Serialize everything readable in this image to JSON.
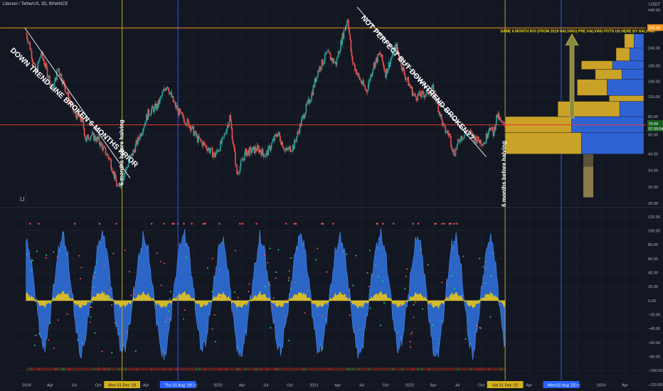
{
  "header": {
    "symbol_text": "Litecoin / TetherUS, 3D, BINANCE",
    "currency": "USDT"
  },
  "logo_text": "ʇ⅃",
  "colors": {
    "background": "#131722",
    "grid": "#1f2433",
    "candle_up": "#26a69a",
    "candle_down": "#ef5350",
    "trend_line": "#e8e8e8",
    "horizontal_orange": "#f7931a",
    "horizontal_red": "#e53935",
    "vertical_yellow": "#d6b01e",
    "vertical_blue": "#2962ff",
    "osc_blue": "#2f6ed8",
    "osc_yellow": "#e5c21b",
    "annotation_yellow": "#f5d90a",
    "vp_gold": "#c9a227",
    "vp_blue": "#2f63d3",
    "vp_tan": "#8b7a4a",
    "arrow_fill": "#8b8a3a",
    "price_tag": "#1b5e20"
  },
  "chart_data": [
    {
      "type": "candlestick",
      "title": "Litecoin / TetherUS, 3D, BINANCE",
      "y_scale": "log",
      "ylim": [
        20,
        460
      ],
      "y_ticks": [
        {
          "value": 440,
          "label": "440.00"
        },
        {
          "value": 320,
          "label": "320.00"
        },
        {
          "value": 240,
          "label": "240.00"
        },
        {
          "value": 180,
          "label": "180.00"
        },
        {
          "value": 140,
          "label": "140.00"
        },
        {
          "value": 110,
          "label": "110.00"
        },
        {
          "value": 80,
          "label": "80.00"
        },
        {
          "value": 60,
          "label": "60.00"
        },
        {
          "value": 44,
          "label": "44.00"
        },
        {
          "value": 34,
          "label": "34.00"
        },
        {
          "value": 26,
          "label": "26.00"
        },
        {
          "value": 20,
          "label": "20.00"
        }
      ],
      "x_ticks": [
        "2018",
        "Apr",
        "Jul",
        "Oct",
        "Mon 31 Dec '18",
        "Apr",
        "Thu 01 Aug '19",
        "Oct",
        "2020",
        "Apr",
        "Jul",
        "Oct",
        "2021",
        "Apr",
        "Jul",
        "Oct",
        "2022",
        "Apr",
        "Jul",
        "Oct",
        "Sat 31 Dec '22",
        "Apr",
        "Wed 02 Aug '23",
        "Oct",
        "2024",
        "Apr"
      ],
      "price_path": [
        {
          "date": "2017-12-30",
          "close": 300
        },
        {
          "date": "2018-01-10",
          "close": 260
        },
        {
          "date": "2018-02-05",
          "close": 160
        },
        {
          "date": "2018-02-25",
          "close": 220
        },
        {
          "date": "2018-03-20",
          "close": 165
        },
        {
          "date": "2018-04-10",
          "close": 120
        },
        {
          "date": "2018-05-01",
          "close": 175
        },
        {
          "date": "2018-06-01",
          "close": 120
        },
        {
          "date": "2018-07-01",
          "close": 85
        },
        {
          "date": "2018-08-01",
          "close": 75
        },
        {
          "date": "2018-08-15",
          "close": 55
        },
        {
          "date": "2018-09-01",
          "close": 60
        },
        {
          "date": "2018-10-01",
          "close": 55
        },
        {
          "date": "2018-11-15",
          "close": 40
        },
        {
          "date": "2018-12-15",
          "close": 25
        },
        {
          "date": "2019-01-10",
          "close": 33
        },
        {
          "date": "2019-02-10",
          "close": 45
        },
        {
          "date": "2019-03-10",
          "close": 60
        },
        {
          "date": "2019-04-10",
          "close": 85
        },
        {
          "date": "2019-05-15",
          "close": 95
        },
        {
          "date": "2019-06-20",
          "close": 135
        },
        {
          "date": "2019-07-15",
          "close": 100
        },
        {
          "date": "2019-08-15",
          "close": 80
        },
        {
          "date": "2019-09-15",
          "close": 70
        },
        {
          "date": "2019-10-15",
          "close": 56
        },
        {
          "date": "2019-11-15",
          "close": 50
        },
        {
          "date": "2019-12-20",
          "close": 43
        },
        {
          "date": "2020-01-20",
          "close": 55
        },
        {
          "date": "2020-02-15",
          "close": 80
        },
        {
          "date": "2020-03-13",
          "close": 32
        },
        {
          "date": "2020-04-15",
          "close": 45
        },
        {
          "date": "2020-06-01",
          "close": 48
        },
        {
          "date": "2020-07-01",
          "close": 43
        },
        {
          "date": "2020-08-15",
          "close": 62
        },
        {
          "date": "2020-09-15",
          "close": 46
        },
        {
          "date": "2020-10-15",
          "close": 50
        },
        {
          "date": "2020-11-25",
          "close": 85
        },
        {
          "date": "2020-12-20",
          "close": 110
        },
        {
          "date": "2021-01-15",
          "close": 165
        },
        {
          "date": "2021-02-20",
          "close": 220
        },
        {
          "date": "2021-03-25",
          "close": 185
        },
        {
          "date": "2021-04-20",
          "close": 290
        },
        {
          "date": "2021-05-10",
          "close": 390
        },
        {
          "date": "2021-05-25",
          "close": 200
        },
        {
          "date": "2021-06-20",
          "close": 150
        },
        {
          "date": "2021-07-20",
          "close": 120
        },
        {
          "date": "2021-08-15",
          "close": 180
        },
        {
          "date": "2021-09-10",
          "close": 220
        },
        {
          "date": "2021-10-01",
          "close": 160
        },
        {
          "date": "2021-11-10",
          "close": 250
        },
        {
          "date": "2021-12-10",
          "close": 160
        },
        {
          "date": "2022-01-20",
          "close": 110
        },
        {
          "date": "2022-03-01",
          "close": 115
        },
        {
          "date": "2022-04-01",
          "close": 125
        },
        {
          "date": "2022-05-12",
          "close": 65
        },
        {
          "date": "2022-06-01",
          "close": 60
        },
        {
          "date": "2022-06-18",
          "close": 44
        },
        {
          "date": "2022-07-15",
          "close": 58
        },
        {
          "date": "2022-08-15",
          "close": 62
        },
        {
          "date": "2022-09-15",
          "close": 55
        },
        {
          "date": "2022-10-15",
          "close": 53
        },
        {
          "date": "2022-11-01",
          "close": 70
        },
        {
          "date": "2022-11-15",
          "close": 60
        },
        {
          "date": "2022-11-30",
          "close": 82
        },
        {
          "date": "2022-12-20",
          "close": 70
        },
        {
          "date": "2022-12-31",
          "close": 70
        }
      ],
      "horizontal_lines": [
        {
          "price": 330,
          "color": "orange"
        },
        {
          "price": 70.04,
          "color": "red"
        }
      ],
      "price_labels": [
        {
          "text": "335.40",
          "price": 330,
          "bg": "#f7931a"
        },
        {
          "text": "70.04",
          "price": 71.5,
          "bg": "#1b5e20"
        },
        {
          "text": "07:39:54",
          "price": 66,
          "bg": "#1b5e20"
        }
      ],
      "vertical_markers": [
        {
          "date": "2018-12-31",
          "label": "Mon 31 Dec '18",
          "color": "yellow"
        },
        {
          "date": "2019-08-01",
          "label": "Thu 01 Aug '19",
          "color": "blue"
        },
        {
          "date": "2022-12-31",
          "label": "Sat 31 Dec '22",
          "color": "yellow"
        },
        {
          "date": "2023-08-02",
          "label": "Wed 02 Aug '23",
          "color": "blue"
        }
      ],
      "trend_lines": [
        {
          "from": {
            "date": "2017-12-25",
            "price": 330
          },
          "to": {
            "date": "2019-01-30",
            "price": 30
          }
        },
        {
          "from": {
            "date": "2021-06-15",
            "price": 460
          },
          "to": {
            "date": "2022-10-20",
            "price": 42
          }
        }
      ],
      "annotations": [
        {
          "text": "DOWN TREND LINE BROKEN 6 MONTHS PRIOR",
          "at": {
            "date": "2018-06-25",
            "price": 90
          },
          "rotation": 43
        },
        {
          "text": "NOT PERFECT BUT DOWNTREND BROKEN??",
          "at": {
            "date": "2022-01-25",
            "price": 145
          },
          "rotation": 48
        },
        {
          "text": "6 months before halving",
          "at": {
            "date": "2019-01-05",
            "price": 45
          },
          "rotation": -90
        },
        {
          "text": "6 months before halving",
          "at": {
            "date": "2023-01-03",
            "price": 32
          },
          "rotation": -90
        },
        {
          "text": "SAME 6 MONTH ROI (FROM 2019 HALVING) PRE HALVING PUTS US HERE BY HALVING"
        }
      ],
      "projection_arrow": {
        "from_price": 78,
        "to_price": 300
      },
      "volume_profile": [
        {
          "price_low": 22,
          "price_high": 36,
          "volume": 0.08,
          "split": 1.0
        },
        {
          "price_low": 44,
          "price_high": 62,
          "volume": 1.0,
          "split": 0.45
        },
        {
          "price_low": 62,
          "price_high": 80,
          "volume": 1.0,
          "split": 0.52
        },
        {
          "price_low": 80,
          "price_high": 102,
          "volume": 0.62,
          "split": 0.28
        },
        {
          "price_low": 102,
          "price_high": 112,
          "volume": 0.25,
          "split": 0.0
        },
        {
          "price_low": 112,
          "price_high": 145,
          "volume": 0.48,
          "split": 0.55
        },
        {
          "price_low": 145,
          "price_high": 170,
          "volume": 0.35,
          "split": 0.45
        },
        {
          "price_low": 170,
          "price_high": 195,
          "volume": 0.45,
          "split": 0.5
        },
        {
          "price_low": 195,
          "price_high": 240,
          "volume": 0.2,
          "split": 0.5
        },
        {
          "price_low": 240,
          "price_high": 300,
          "volume": 0.14,
          "split": 0.5
        }
      ]
    },
    {
      "type": "area",
      "ylim": [
        -110,
        125
      ],
      "y_ticks": [
        120,
        100,
        80,
        60,
        40,
        20,
        0,
        -20,
        -40,
        -60,
        -80,
        -100,
        -120
      ],
      "y_tick_labels": [
        "120.00",
        "100.00",
        "80.00",
        "60.00",
        "40.00",
        "20.00",
        "0.00",
        "−20.00",
        "−40.00",
        "−60.00",
        "−80.00",
        "−100.00",
        "−120.00"
      ],
      "series": [
        {
          "values": [
            85,
            65,
            20,
            -30,
            -70,
            -55,
            -10,
            40,
            80,
            95,
            60,
            10,
            -40,
            -80,
            -60,
            -20,
            30,
            70,
            95,
            85,
            40,
            -10,
            -50,
            -75,
            -60,
            -25,
            20,
            60,
            90,
            80,
            35,
            -15,
            -60,
            -85,
            -55,
            -5,
            45,
            85,
            95,
            70,
            20,
            -35,
            -70,
            -60,
            -20,
            25,
            70,
            90,
            60,
            10,
            -45,
            -80,
            -70,
            -30,
            15,
            55,
            90,
            75,
            30,
            -20,
            -60,
            -75,
            -40,
            0,
            50,
            85,
            95,
            65,
            15,
            -40,
            -75,
            -65,
            -25,
            20,
            65,
            90,
            80,
            35,
            -20,
            -65,
            -80,
            -50,
            -5,
            45,
            80,
            95,
            70,
            25,
            -30,
            -70,
            -60,
            -15,
            30,
            75,
            95,
            60,
            5,
            -50,
            -85,
            -65,
            -20,
            35,
            80,
            90,
            55,
            0,
            -55,
            -80,
            -45,
            10,
            60,
            92,
            75,
            20,
            -40,
            -70
          ]
        },
        {
          "values": [
            10,
            6,
            2,
            -4,
            -8,
            -5,
            -1,
            5,
            9,
            12,
            7,
            2,
            -5,
            -9,
            -6,
            -2,
            4,
            8,
            11,
            9,
            5,
            -1,
            -6,
            -8,
            -6,
            -3,
            3,
            7,
            10,
            8,
            4,
            -2,
            -7,
            -9,
            -5,
            0,
            5,
            9,
            11,
            7,
            2,
            -4,
            -8,
            -6,
            -2,
            3,
            8,
            10,
            6,
            1,
            -5,
            -9,
            -7,
            -3,
            2,
            6,
            10,
            8,
            3,
            -2,
            -7,
            -8,
            -4,
            0,
            6,
            9,
            11,
            7,
            2,
            -5,
            -8,
            -7,
            -3,
            2,
            7,
            10,
            9,
            4,
            -2,
            -7,
            -9,
            -5,
            -1,
            5,
            9,
            11,
            8,
            3,
            -3,
            -8,
            -6,
            -2,
            3,
            8,
            10,
            6,
            1,
            -6,
            -9,
            -7,
            -2,
            4,
            9,
            10,
            6,
            0,
            -6,
            -9,
            -5,
            1,
            7,
            10,
            8,
            2,
            -4,
            -8
          ]
        }
      ],
      "xlim_series": [
        "2017-12-30",
        "2022-12-31"
      ]
    }
  ]
}
